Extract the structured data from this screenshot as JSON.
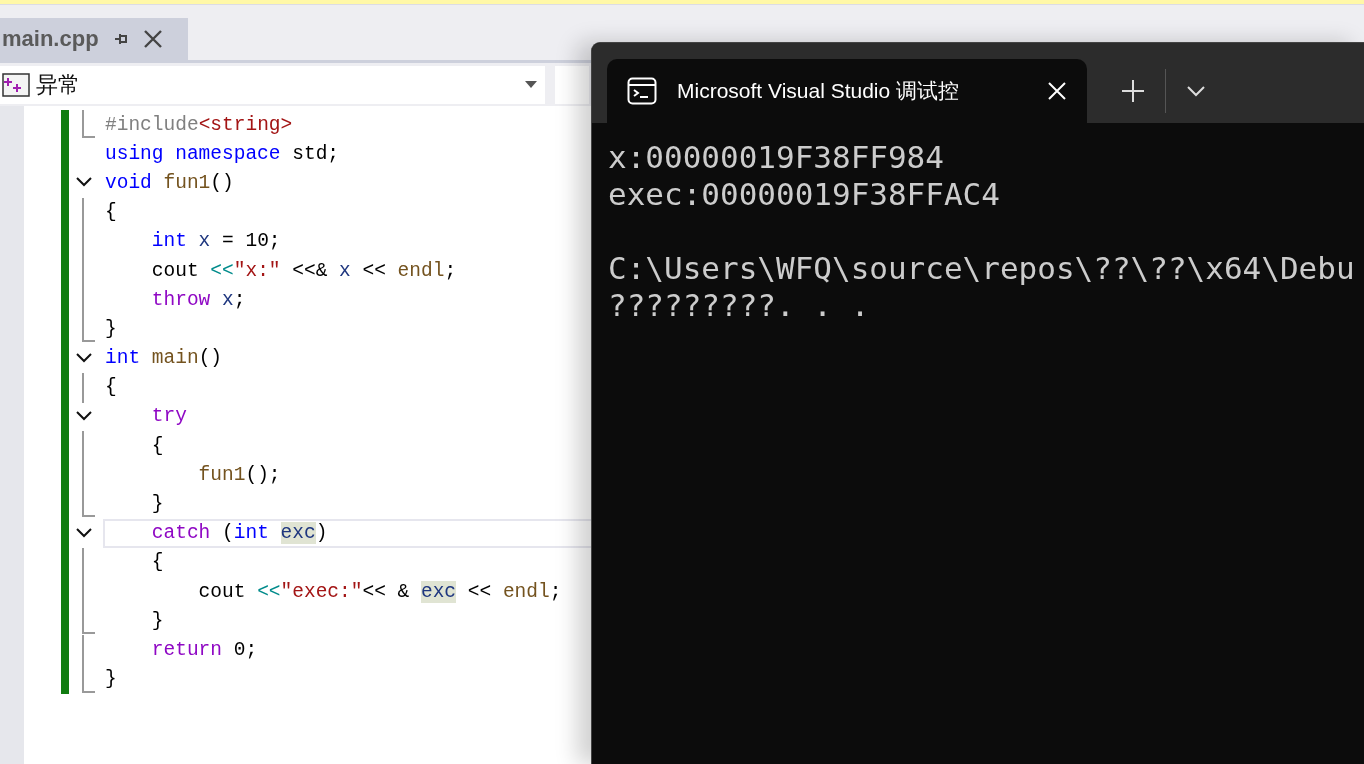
{
  "editor_tab": {
    "title": "main.cpp",
    "selected": true
  },
  "navigation_bar": {
    "scope": "异常"
  },
  "code_lines": [
    {
      "kind": "end",
      "current": false,
      "tokens": [
        {
          "t": "#include",
          "kind": "preproc"
        },
        {
          "t": "<string>",
          "kind": "string"
        }
      ]
    },
    {
      "kind": "none",
      "current": false,
      "tokens": [
        {
          "t": "using namespace",
          "kind": "keyword"
        },
        {
          "t": " std;",
          "kind": "plain"
        }
      ]
    },
    {
      "kind": "toggle",
      "current": false,
      "tokens": [
        {
          "t": "void",
          "kind": "keyword"
        },
        {
          "t": " fun1",
          "kind": "func"
        },
        {
          "t": "()",
          "kind": "plain"
        }
      ]
    },
    {
      "kind": "line",
      "current": false,
      "tokens": [
        {
          "t": "{",
          "kind": "plain"
        }
      ]
    },
    {
      "kind": "line",
      "current": false,
      "tokens": [
        {
          "t": "    int",
          "kind": "keyword"
        },
        {
          "t": " x",
          "kind": "var"
        },
        {
          "t": " = 10;",
          "kind": "plain"
        }
      ]
    },
    {
      "kind": "line",
      "current": false,
      "tokens": [
        {
          "t": "    cout ",
          "kind": "plain"
        },
        {
          "t": "<<",
          "kind": "operator"
        },
        {
          "t": "\"x:\"",
          "kind": "string"
        },
        {
          "t": " <<& ",
          "kind": "plain"
        },
        {
          "t": "x",
          "kind": "var"
        },
        {
          "t": " << ",
          "kind": "plain"
        },
        {
          "t": "endl",
          "kind": "func"
        },
        {
          "t": ";",
          "kind": "plain"
        }
      ]
    },
    {
      "kind": "line",
      "current": false,
      "tokens": [
        {
          "t": "    throw",
          "kind": "control"
        },
        {
          "t": " x",
          "kind": "var"
        },
        {
          "t": ";",
          "kind": "plain"
        }
      ]
    },
    {
      "kind": "end",
      "current": false,
      "tokens": [
        {
          "t": "}",
          "kind": "plain"
        }
      ]
    },
    {
      "kind": "toggle",
      "current": false,
      "tokens": [
        {
          "t": "int",
          "kind": "keyword"
        },
        {
          "t": " main",
          "kind": "func"
        },
        {
          "t": "()",
          "kind": "plain"
        }
      ]
    },
    {
      "kind": "line",
      "current": false,
      "tokens": [
        {
          "t": "{",
          "kind": "plain"
        }
      ]
    },
    {
      "kind": "toggle",
      "current": false,
      "tokens": [
        {
          "t": "    try",
          "kind": "control"
        }
      ]
    },
    {
      "kind": "line",
      "current": false,
      "tokens": [
        {
          "t": "    {",
          "kind": "plain"
        }
      ]
    },
    {
      "kind": "line",
      "current": false,
      "tokens": [
        {
          "t": "        fun1",
          "kind": "func"
        },
        {
          "t": "();",
          "kind": "plain"
        }
      ]
    },
    {
      "kind": "end",
      "current": false,
      "tokens": [
        {
          "t": "    }",
          "kind": "plain"
        }
      ]
    },
    {
      "kind": "toggle",
      "current": true,
      "tokens": [
        {
          "t": "    catch",
          "kind": "control"
        },
        {
          "t": " (",
          "kind": "plain"
        },
        {
          "t": "int ",
          "kind": "keyword"
        },
        {
          "t": "exc",
          "kind": "var",
          "highlight": true
        },
        {
          "t": ")",
          "kind": "plain"
        }
      ]
    },
    {
      "kind": "line",
      "current": false,
      "tokens": [
        {
          "t": "    {",
          "kind": "plain"
        }
      ]
    },
    {
      "kind": "line",
      "current": false,
      "tokens": [
        {
          "t": "        cout ",
          "kind": "plain"
        },
        {
          "t": "<<",
          "kind": "operator"
        },
        {
          "t": "\"exec:\"",
          "kind": "string"
        },
        {
          "t": "<< & ",
          "kind": "plain"
        },
        {
          "t": "exc",
          "kind": "var",
          "highlight": true
        },
        {
          "t": " << ",
          "kind": "plain"
        },
        {
          "t": "endl",
          "kind": "func"
        },
        {
          "t": ";",
          "kind": "plain"
        }
      ]
    },
    {
      "kind": "end",
      "current": false,
      "tokens": [
        {
          "t": "    }",
          "kind": "plain"
        }
      ]
    },
    {
      "kind": "line",
      "current": false,
      "tokens": [
        {
          "t": "    return",
          "kind": "control"
        },
        {
          "t": " 0;",
          "kind": "plain"
        }
      ]
    },
    {
      "kind": "end",
      "current": false,
      "tokens": [
        {
          "t": "}",
          "kind": "plain"
        }
      ]
    }
  ],
  "console": {
    "tab_title": "Microsoft Visual Studio 调试控",
    "output_blocks": [
      [
        "x:00000019F38FF984",
        "exec:00000019F38FFAC4"
      ],
      [
        "C:\\Users\\WFQ\\source\\repos\\??\\??\\x64\\Debu",
        "?????????. . ."
      ]
    ]
  }
}
